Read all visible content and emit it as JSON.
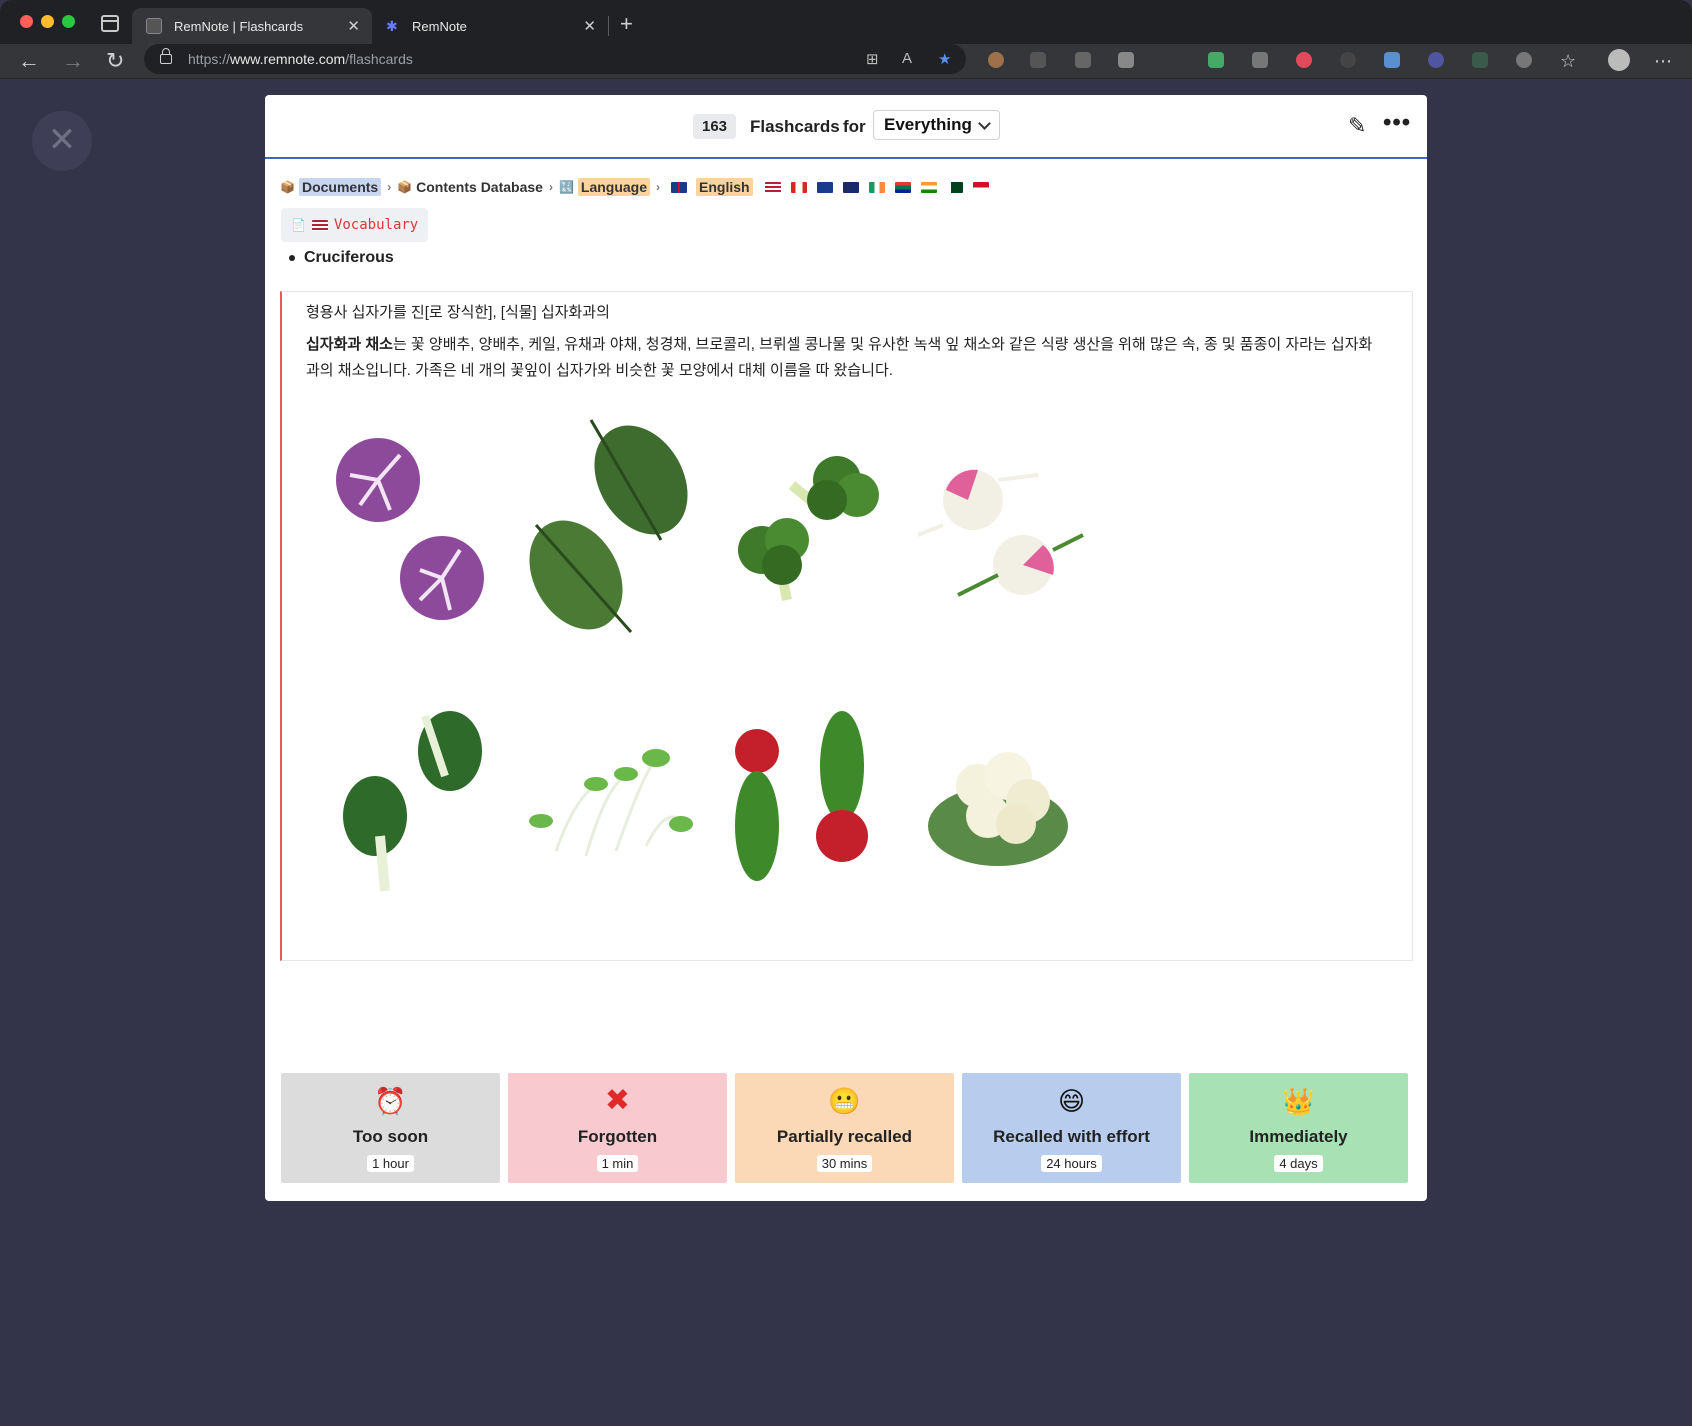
{
  "browser": {
    "tabs": [
      {
        "title": "RemNote | Flashcards",
        "active": true
      },
      {
        "title": "RemNote",
        "active": false
      }
    ],
    "url_prefix": "https://",
    "url_host": "www.remnote.com",
    "url_path": "/flashcards"
  },
  "header": {
    "count": "163",
    "flashcards_label": "Flashcards",
    "for_label": "for",
    "scope": "Everything"
  },
  "breadcrumb": {
    "items": [
      "Documents",
      "Contents Database",
      "Language",
      "English"
    ]
  },
  "document": {
    "vocab_chip": "Vocabulary",
    "card_front": "Cruciferous",
    "answer_line1": "형용사  십자가를 진[로 장식한], [식물] 십자화과의",
    "answer_bold": "십자화과 채소",
    "answer_rest": "는 꽃 양배추,  양배추, 케일, 유채과 야채, 청경채, 브로콜리, 브뤼셀 콩나물 및 유사한 녹색 잎 채소와 같은 식량 생산을 위해 많은 속, 종 및  품종이 자라는 십자화과의 채소입니다. 가족은 네 개의 꽃잎이 십자가와 비슷한 꽃 모양에서 대체 이름을 따 왔습니다."
  },
  "vegetables": [
    {
      "name": "cabbage",
      "bg": "#b3c65c"
    },
    {
      "name": "kale",
      "bg": "#f7979c"
    },
    {
      "name": "broccoli",
      "bg": "#4f55a0"
    },
    {
      "name": "kohlrabi",
      "bg": "#b3c65c"
    },
    {
      "name": "bok choy",
      "bg": "#f7979c"
    },
    {
      "name": "watercress",
      "bg": "#4f55a0"
    },
    {
      "name": "radish",
      "bg": "#b3c65c"
    },
    {
      "name": "cauliflower",
      "bg": "#f7979c"
    }
  ],
  "ratings": [
    {
      "label": "Too soon",
      "time": "1 hour",
      "icon": "alarm-clock-icon",
      "bg": "#dcdcdc"
    },
    {
      "label": "Forgotten",
      "time": "1 min",
      "icon": "cross-mark-icon",
      "bg": "#f8c9ce"
    },
    {
      "label": "Partially recalled",
      "time": "30 mins",
      "icon": "grimace-face-icon",
      "bg": "#fcd9b6"
    },
    {
      "label": "Recalled with effort",
      "time": "24 hours",
      "icon": "grin-face-icon",
      "bg": "#b8cdee"
    },
    {
      "label": "Immediately",
      "time": "4 days",
      "icon": "crown-icon",
      "bg": "#a8e2b4"
    }
  ]
}
